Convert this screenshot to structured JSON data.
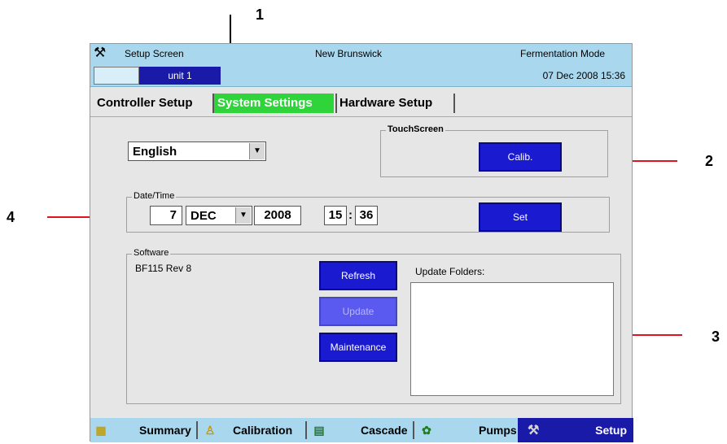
{
  "callouts": [
    "1",
    "2",
    "3",
    "4"
  ],
  "titlebar": {
    "left": "Setup Screen",
    "center": "New Brunswick",
    "right": "Fermentation Mode"
  },
  "unitbar": {
    "unit": "unit 1",
    "datetime": "07 Dec 2008  15:36"
  },
  "tabs": [
    "Controller Setup",
    "System Settings",
    "Hardware Setup"
  ],
  "language": {
    "value": "English"
  },
  "touchscreen": {
    "legend": "TouchScreen",
    "calib_label": "Calib."
  },
  "datetime": {
    "legend": "Date/Time",
    "day": "7",
    "month": "DEC",
    "year": "2008",
    "hour": "15",
    "sep": ":",
    "minute": "36",
    "set_label": "Set"
  },
  "software": {
    "legend": "Software",
    "version": "BF115 Rev 8",
    "refresh_label": "Refresh",
    "update_label": "Update",
    "maintenance_label": "Maintenance",
    "folders_label": "Update Folders:"
  },
  "bottom": {
    "summary": "Summary",
    "calibration": "Calibration",
    "cascade": "Cascade",
    "pumps": "Pumps",
    "setup": "Setup"
  },
  "icons": {
    "wrench": "wrench-icon",
    "grid": "grid-icon",
    "probe": "probe-icon",
    "cascade": "cascade-icon",
    "pump": "pump-icon"
  },
  "colors": {
    "header_bg": "#a9d8ee",
    "active_tab": "#2fd43a",
    "button_blue": "#1a1ad0",
    "callout_line": "#e0141e"
  }
}
